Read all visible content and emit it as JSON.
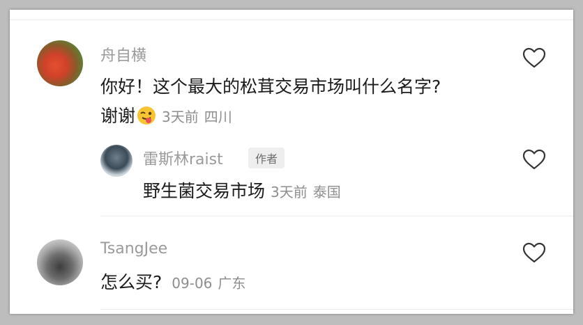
{
  "comments": [
    {
      "username": "舟自横",
      "text_line1": "你好！这个最大的松茸交易市场叫什么名字?",
      "text_line2": "谢谢",
      "time": "3天前",
      "location": "四川",
      "emoji": "winking-face-with-tongue-emoji",
      "reply": {
        "username": "雷斯林raist",
        "tag": "作者",
        "text": "野生菌交易市场",
        "time": "3天前",
        "location": "泰国"
      }
    },
    {
      "username": "TsangJee",
      "text": "怎么买?",
      "time": "09-06",
      "location": "广东"
    }
  ],
  "icons": {
    "like": "heart-outline-icon"
  },
  "colors": {
    "username": "#9a9a9a",
    "text": "#1b1b1b",
    "meta": "#8e8e8e"
  }
}
